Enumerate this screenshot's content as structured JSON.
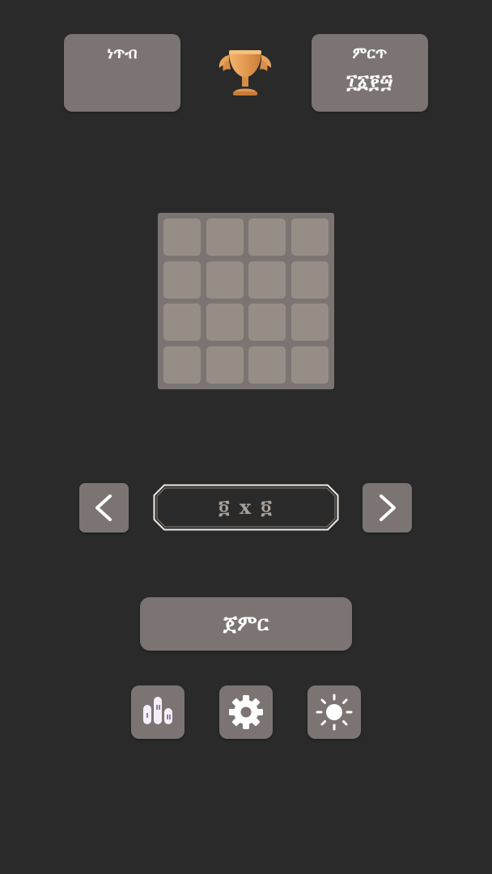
{
  "header": {
    "score_label": "ነጥብ",
    "score_value": "",
    "best_label": "ምርጥ",
    "best_value": "፲፩፻፵"
  },
  "trophy_icon": "trophy-icon",
  "board": {
    "rows": 4,
    "cols": 4
  },
  "size_selector": {
    "prev_icon": "chevron-left-icon",
    "next_icon": "chevron-right-icon",
    "value": "፬ x ፬"
  },
  "start_button": {
    "label": "ጀምር"
  },
  "toolbar": {
    "stats_icon": "leaderboard-icon",
    "settings_icon": "gear-icon",
    "theme_icon": "sun-icon"
  },
  "colors": {
    "background": "#2a2a2a",
    "panel": "#7b7472",
    "tile": "#978d87",
    "size_text": "#a8a09b",
    "trophy": "#e6a25a"
  }
}
